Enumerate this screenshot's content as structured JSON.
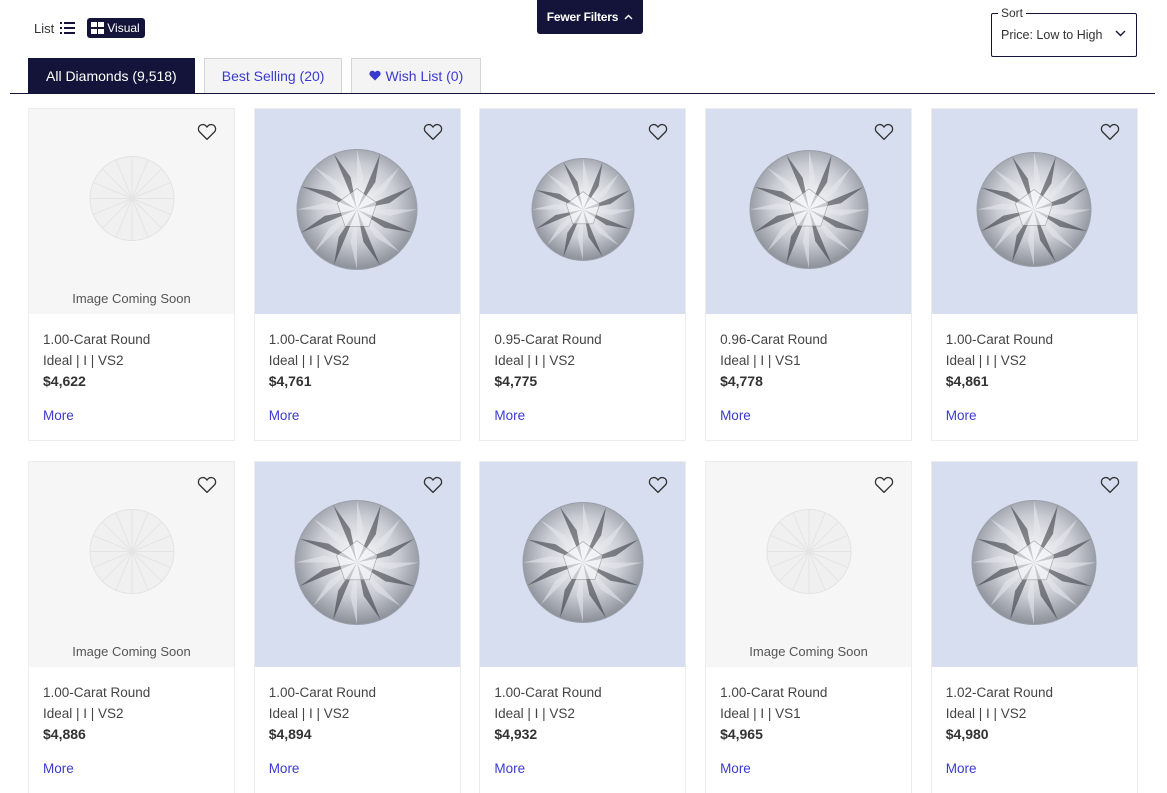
{
  "view_toggle": {
    "list_label": "List",
    "visual_label": "Visual"
  },
  "filters_button": {
    "label": "Fewer Filters"
  },
  "sort": {
    "legend": "Sort",
    "value": "Price: Low to High"
  },
  "tabs": [
    {
      "label": "All Diamonds (9,518)",
      "active": true
    },
    {
      "label": "Best Selling (20)",
      "active": false
    },
    {
      "label": "Wish List (0)",
      "active": false,
      "icon": "heart-icon"
    }
  ],
  "coming_soon_text": "Image Coming Soon",
  "more_label": "More",
  "colors": {
    "navy": "#14143a",
    "link": "#3a3acf",
    "image_blue": "#d6deef",
    "image_gray": "#f6f6f6"
  },
  "diamonds": [
    {
      "title": "1.00-Carat Round",
      "spec": "Ideal | I | VS2",
      "price": "$4,622",
      "image": "coming-soon"
    },
    {
      "title": "1.00-Carat Round",
      "spec": "Ideal | I | VS2",
      "price": "$4,761",
      "image": "photo"
    },
    {
      "title": "0.95-Carat Round",
      "spec": "Ideal | I | VS2",
      "price": "$4,775",
      "image": "photo"
    },
    {
      "title": "0.96-Carat Round",
      "spec": "Ideal | I | VS1",
      "price": "$4,778",
      "image": "photo"
    },
    {
      "title": "1.00-Carat Round",
      "spec": "Ideal | I | VS2",
      "price": "$4,861",
      "image": "photo"
    },
    {
      "title": "1.00-Carat Round",
      "spec": "Ideal | I | VS2",
      "price": "$4,886",
      "image": "coming-soon"
    },
    {
      "title": "1.00-Carat Round",
      "spec": "Ideal | I | VS2",
      "price": "$4,894",
      "image": "photo"
    },
    {
      "title": "1.00-Carat Round",
      "spec": "Ideal | I | VS2",
      "price": "$4,932",
      "image": "photo"
    },
    {
      "title": "1.00-Carat Round",
      "spec": "Ideal | I | VS1",
      "price": "$4,965",
      "image": "coming-soon"
    },
    {
      "title": "1.02-Carat Round",
      "spec": "Ideal | I | VS2",
      "price": "$4,980",
      "image": "photo"
    }
  ]
}
